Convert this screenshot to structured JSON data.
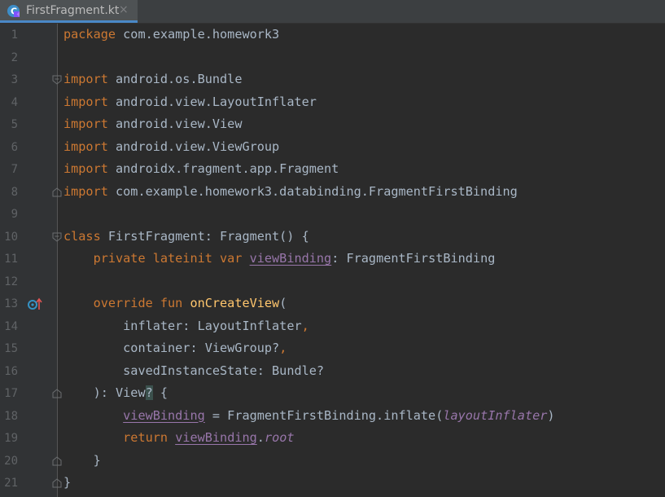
{
  "tab": {
    "label": "FirstFragment.kt",
    "close": "×"
  },
  "line_numbers": [
    "1",
    "2",
    "3",
    "4",
    "5",
    "6",
    "7",
    "8",
    "9",
    "10",
    "11",
    "12",
    "13",
    "14",
    "15",
    "16",
    "17",
    "18",
    "19",
    "20",
    "21"
  ],
  "code": {
    "l1": {
      "kw": "package",
      "rest": " com.example.homework3"
    },
    "l3": {
      "kw": "import",
      "rest": " android.os.Bundle"
    },
    "l4": {
      "kw": "import",
      "rest": " android.view.LayoutInflater"
    },
    "l5": {
      "kw": "import",
      "rest": " android.view.View"
    },
    "l6": {
      "kw": "import",
      "rest": " android.view.ViewGroup"
    },
    "l7": {
      "kw": "import",
      "rest": " androidx.fragment.app.Fragment"
    },
    "l8": {
      "kw": "import",
      "rest": " com.example.homework3.databinding.FragmentFirstBinding"
    },
    "l10": {
      "kw": "class",
      "rest": " FirstFragment: Fragment() {"
    },
    "l11": {
      "kw": "private lateinit var",
      "prop": "viewBinding",
      "rest": ": FragmentFirstBinding"
    },
    "l13": {
      "kw": "override fun",
      "fn": "onCreateView",
      "rest": "("
    },
    "l14": {
      "text": "inflater: LayoutInflater",
      "comma": ","
    },
    "l15": {
      "text": "container: ViewGroup?",
      "comma": ","
    },
    "l16": {
      "text": "savedInstanceState: Bundle?"
    },
    "l17": {
      "text1": "): View",
      "q": "?",
      "text2": " {"
    },
    "l18": {
      "prop": "viewBinding",
      "mid": " = FragmentFirstBinding.inflate(",
      "ital": "layoutInflater",
      "end": ")"
    },
    "l19": {
      "kw": "return",
      "prop": "viewBinding",
      "dot": ".",
      "ital": "root"
    },
    "l20": {
      "text": "}"
    },
    "l21": {
      "text": "}"
    }
  },
  "colors": {
    "background": "#2b2b2b",
    "keyword": "#cc7832",
    "function": "#ffc66d",
    "property": "#9876aa",
    "text": "#a9b7c6",
    "line_number": "#606366"
  },
  "icons": {
    "tab_icon": "kotlin-file-icon",
    "override_icon": "override-method-icon",
    "fold_icon": "fold-marker-icon"
  }
}
